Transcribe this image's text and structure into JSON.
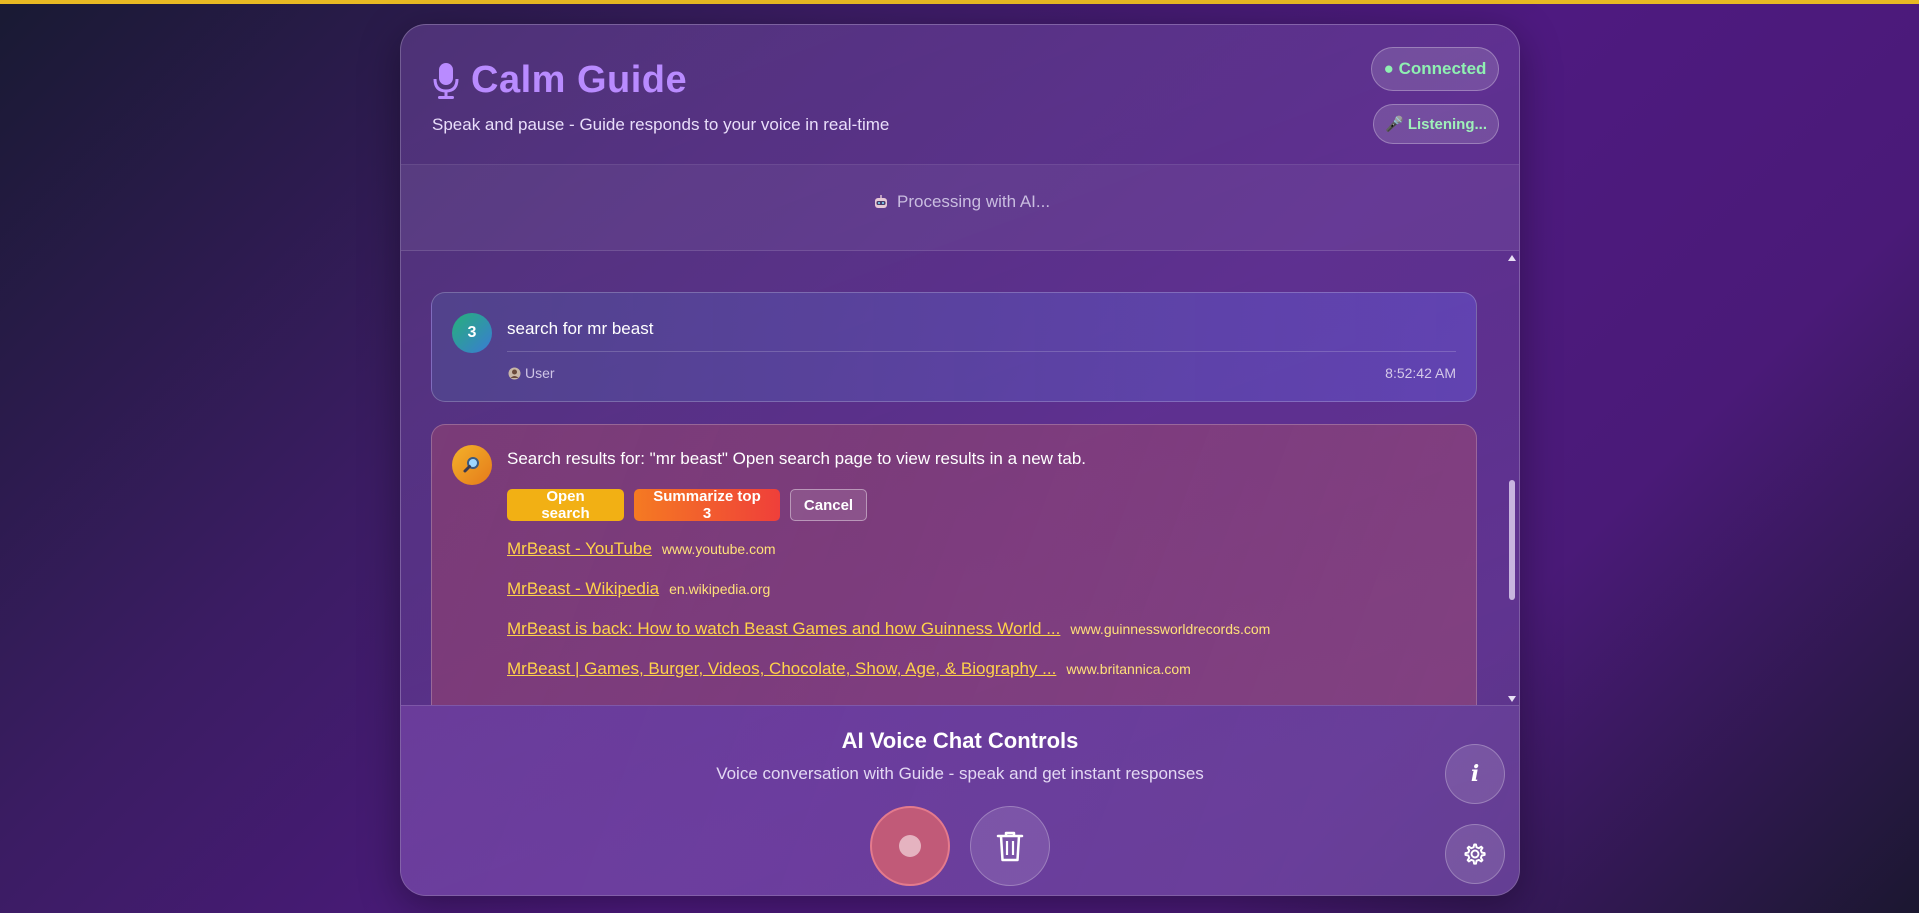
{
  "header": {
    "title": "Calm Guide",
    "subtitle": "Speak and pause - Guide responds to your voice in real-time",
    "status_connected": "● Connected",
    "status_listening": "🎤 Listening..."
  },
  "processing": {
    "text": "Processing with AI..."
  },
  "messages": {
    "user": {
      "number": "3",
      "text": "search for mr beast",
      "role": "User",
      "time": "8:52:42 AM"
    },
    "bot": {
      "text": "Search results for: \"mr beast\" Open search page to view results in a new tab.",
      "actions": {
        "open": "Open search",
        "summarize": "Summarize top 3",
        "cancel": "Cancel"
      },
      "results": [
        {
          "title": "MrBeast - YouTube",
          "domain": "www.youtube.com"
        },
        {
          "title": "MrBeast - Wikipedia",
          "domain": "en.wikipedia.org"
        },
        {
          "title": "MrBeast is back: How to watch Beast Games and how Guinness World ...",
          "domain": "www.guinnessworldrecords.com"
        },
        {
          "title": "MrBeast | Games, Burger, Videos, Chocolate, Show, Age, & Biography ...",
          "domain": "www.britannica.com"
        }
      ]
    }
  },
  "controls": {
    "title": "AI Voice Chat Controls",
    "subtitle": "Voice conversation with Guide - speak and get instant responses",
    "info_label": "i"
  },
  "colors": {
    "accent_title": "#b98bff",
    "status_green": "#8ff0b2",
    "link_yellow": "#ffd24a",
    "open_button": "#f2b014",
    "summarize_button_start": "#f57a22",
    "summarize_button_end": "#ef3f3a",
    "record_button": "#c15a78",
    "top_strip": "#e8b923"
  },
  "icons": {
    "title": "microphone-icon",
    "processing": "robot-icon",
    "user": "user-icon",
    "bot": "magnifier-icon",
    "record": "record-icon",
    "clear": "trash-icon",
    "info": "info-icon",
    "settings": "gear-icon"
  }
}
